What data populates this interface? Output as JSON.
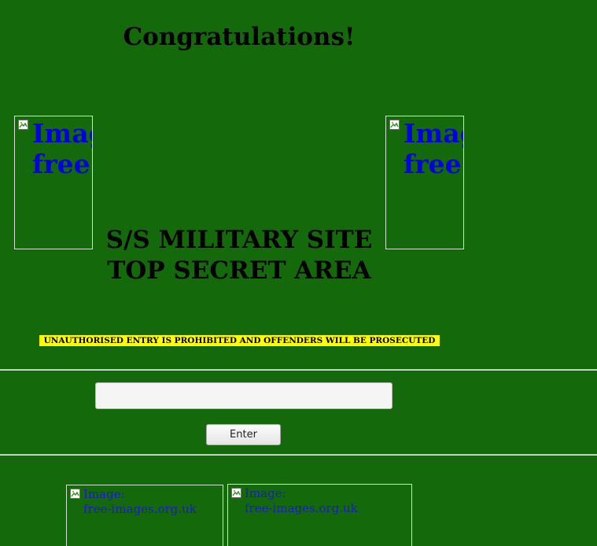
{
  "page": {
    "title": "Congratulations!",
    "heading_line1": "S/S MILITARY SITE",
    "heading_line2": "TOP SECRET AREA",
    "warning": "UNAUTHORISED ENTRY IS PROHIBITED AND OFFENDERS WILL BE PROSECUTED"
  },
  "images": {
    "top_left_alt": "Image: free-images.org.uk",
    "top_right_alt": "Image: free-images.org.uk",
    "bottom_1_alt_line1": "Image:",
    "bottom_1_alt_line2": "free-images.org.uk",
    "bottom_2_alt_line1": "Image:",
    "bottom_2_alt_line2": "free-images.org.uk",
    "top_left_line1": "Imag",
    "top_left_line2": "free",
    "top_right_line1": "Imag",
    "top_right_line2": "free",
    "icon": "broken-image-icon"
  },
  "form": {
    "password_value": "",
    "enter_label": "Enter"
  },
  "colors": {
    "background": "#146a0b",
    "warning_bg": "#ffff00",
    "link": "#0000e0"
  }
}
